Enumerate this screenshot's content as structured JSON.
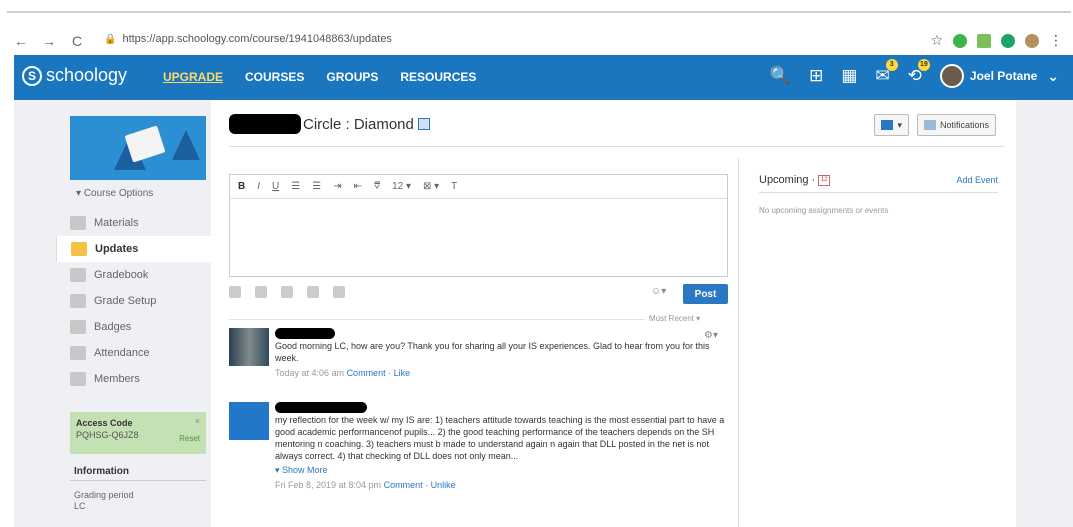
{
  "browser": {
    "url": "https://app.schoology.com/course/1941048863/updates",
    "back": "←",
    "forward": "→",
    "reload": "C"
  },
  "nav": {
    "logo": "schoology",
    "links": [
      "UPGRADE",
      "COURSES",
      "GROUPS",
      "RESOURCES"
    ],
    "mail_badge": "3",
    "notif_badge": "19",
    "user_name": "Joel Potane"
  },
  "sidebar": {
    "course_options": "Course Options",
    "items": [
      "Materials",
      "Updates",
      "Gradebook",
      "Grade Setup",
      "Badges",
      "Attendance",
      "Members"
    ],
    "access_code_label": "Access Code",
    "access_code": "PQHSG-Q6JZ8",
    "reset": "Reset",
    "information": "Information",
    "grading_period_label": "Grading period",
    "grading_period_value": "LC"
  },
  "main": {
    "title": "Circle : Diamond",
    "notifications": "Notifications",
    "post_button": "Post",
    "most_recent": "Most Recent",
    "toolbar": [
      "B",
      "I",
      "U",
      "☰",
      "☰",
      "⇥",
      "⇤",
      "⩢",
      "12 ▾",
      "⊠ ▾",
      "T"
    ],
    "posts": [
      {
        "text": "Good morning LC, how are you? Thank you for sharing all your IS experiences. Glad to hear from you for this week.",
        "time": "Today at 4:06 am",
        "actions": "Comment · Like"
      },
      {
        "text": "my reflection for the week w/ my IS are: 1) teachers attitude towards teaching is the most essential part to have a good academic performancenof pupils... 2) the good teaching performance of the teachers depends on the SH mentoring n coaching. 3) teachers must b made to understand again n again that DLL posted in the net is not always correct. 4) that checking of DLL does not only mean...",
        "show_more": "Show More",
        "time": "Fri Feb 8, 2019 at 8:04 pm",
        "actions": "Comment · Unlike"
      }
    ]
  },
  "upcoming": {
    "title": "Upcoming",
    "add_event": "Add Event",
    "empty": "No upcoming assignments or events"
  }
}
